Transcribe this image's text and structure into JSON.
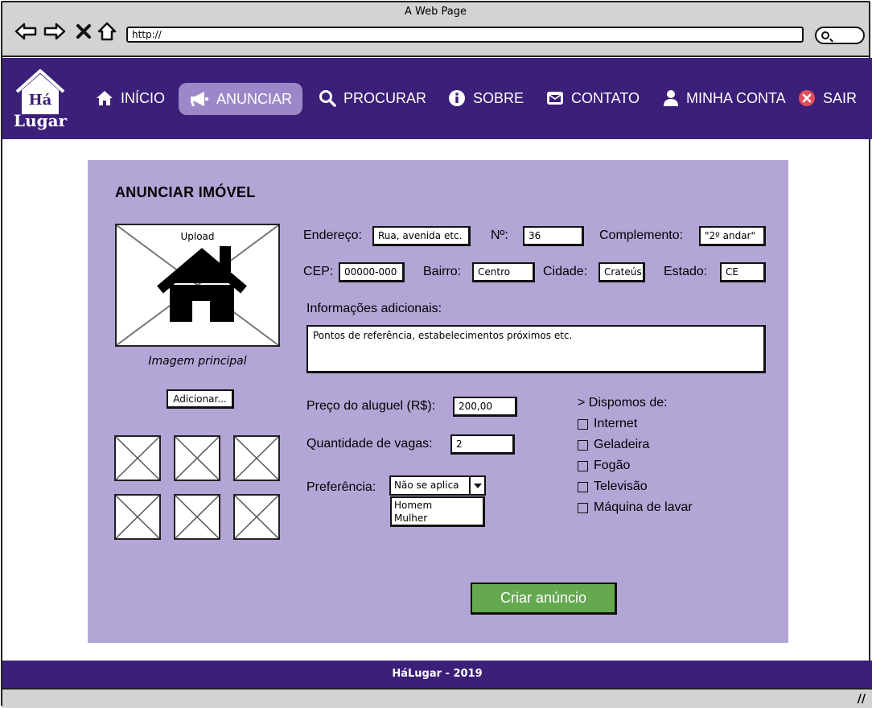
{
  "browser": {
    "window_title": "A Web Page",
    "url": "http://"
  },
  "header": {
    "logo_line1": "Há",
    "logo_line2": "Lugar",
    "nav": [
      {
        "label": "INÍCIO",
        "icon": "home-icon"
      },
      {
        "label": "ANUNCIAR",
        "icon": "megaphone-icon",
        "active": true
      },
      {
        "label": "PROCURAR",
        "icon": "search-icon"
      },
      {
        "label": "SOBRE",
        "icon": "info-icon"
      },
      {
        "label": "CONTATO",
        "icon": "envelope-icon"
      },
      {
        "label": "MINHA CONTA",
        "icon": "user-icon"
      },
      {
        "label": "SAIR",
        "icon": "close-circle-icon"
      }
    ],
    "colors": {
      "header_bg": "#3b1f78",
      "active_bg": "#9c88c8"
    }
  },
  "form": {
    "title": "ANUNCIAR IMÓVEL",
    "upload_label": "Upload",
    "main_image_caption": "Imagem principal",
    "add_button": "Adicionar...",
    "endereco_label": "Endereço:",
    "endereco_value": "Rua, avenida etc.",
    "numero_label": "Nº:",
    "numero_value": "36",
    "complemento_label": "Complemento:",
    "complemento_value": "\"2º andar\"",
    "cep_label": "CEP:",
    "cep_value": "00000-000",
    "bairro_label": "Bairro:",
    "bairro_value": "Centro",
    "cidade_label": "Cidade:",
    "cidade_value": "Crateús",
    "estado_label": "Estado:",
    "estado_value": "CE",
    "info_label": "Informações adicionais:",
    "info_value": "Pontos de referência, estabelecimentos próximos etc.",
    "preco_label": "Preço do aluguel (R$):",
    "preco_value": "200,00",
    "vagas_label": "Quantidade de vagas:",
    "vagas_value": "2",
    "preferencia_label": "Preferência:",
    "preferencia_value": "Não se aplica",
    "preferencia_options": [
      "Homem",
      "Mulher"
    ],
    "amenities_heading": "> Dispomos de:",
    "amenities": [
      "Internet",
      "Geladeira",
      "Fogão",
      "Televisão",
      "Máquina de lavar"
    ],
    "submit": "Criar anúncio",
    "colors": {
      "panel_bg": "#b3a6d6",
      "submit_bg": "#64a94f"
    }
  },
  "footer": {
    "text": "HáLugar - 2019"
  }
}
